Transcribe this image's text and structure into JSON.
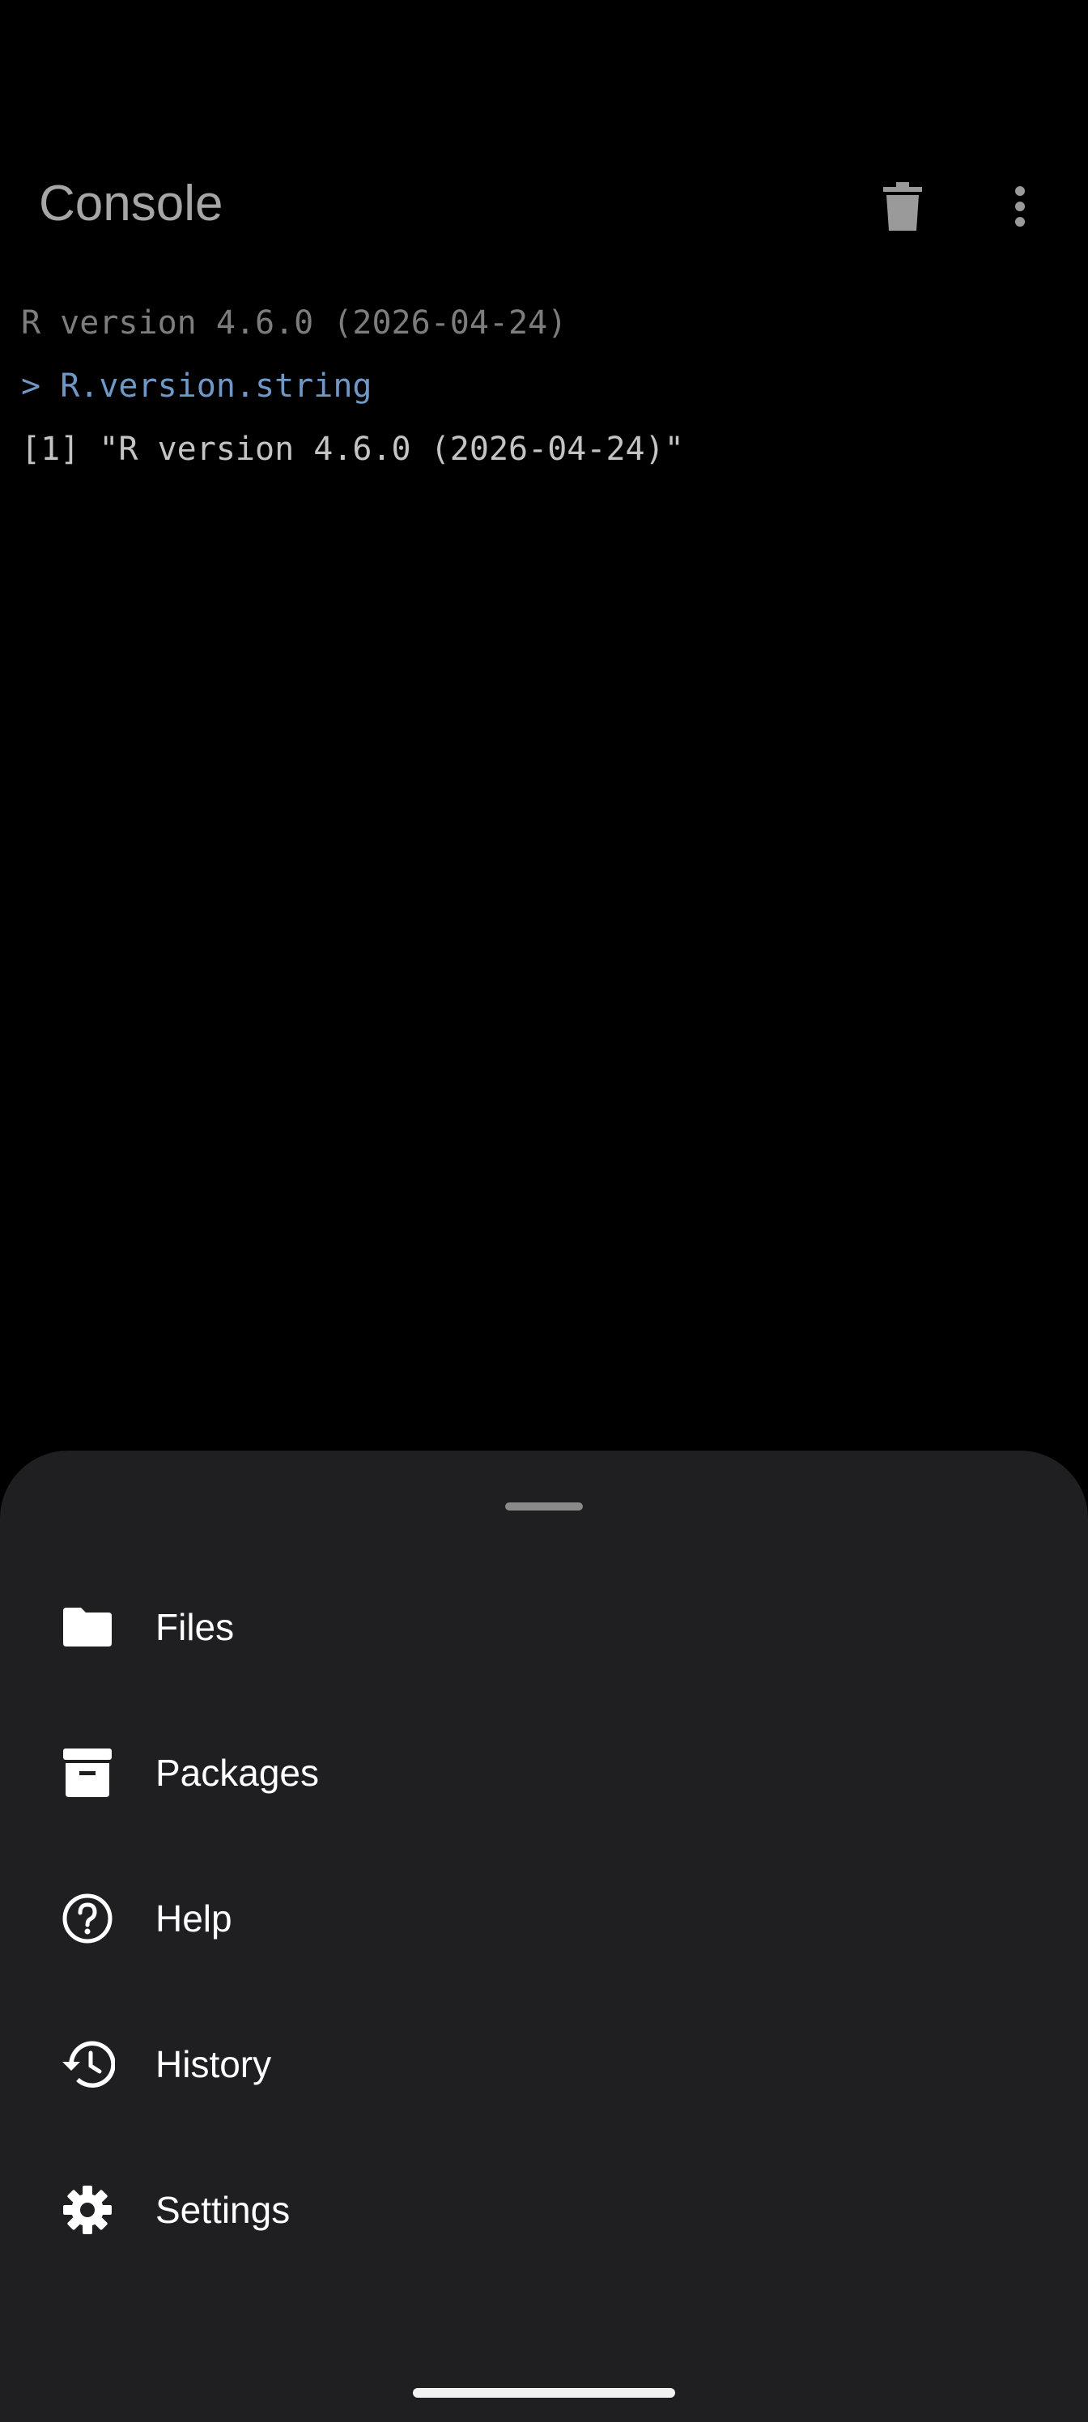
{
  "appbar": {
    "title": "Console",
    "trash_icon": "trash-icon",
    "more_icon": "more-vert-icon"
  },
  "console": {
    "lines": [
      {
        "kind": "banner",
        "text": "R version 4.6.0 (2026-04-24)"
      },
      {
        "kind": "input",
        "prompt": ">",
        "text": "R.version.string"
      },
      {
        "kind": "output",
        "text": "[1] \"R version 4.6.0 (2026-04-24)\""
      }
    ]
  },
  "sheet": {
    "items": [
      {
        "label": "Files",
        "icon": "folder-icon"
      },
      {
        "label": "Packages",
        "icon": "archive-icon"
      },
      {
        "label": "Help",
        "icon": "help-circle-icon"
      },
      {
        "label": "History",
        "icon": "history-icon"
      },
      {
        "label": "Settings",
        "icon": "gear-icon"
      }
    ]
  },
  "colors": {
    "background": "#000000",
    "sheet": "#1f1f21",
    "input_text": "#6f98c6",
    "banner_text": "#7d7d7d",
    "output_text": "#c4c4c4"
  }
}
